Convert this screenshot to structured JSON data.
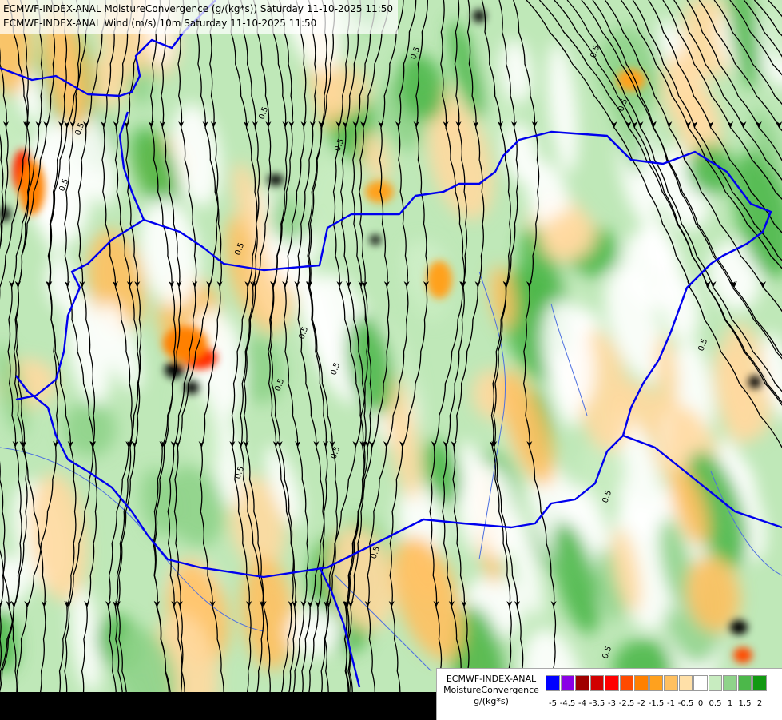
{
  "header": {
    "line1": "ECMWF-INDEX-ANAL MoistureConvergence (g/(kg*s)) Saturday 11-10-2025 11:50",
    "line2": "ECMWF-INDEX-ANAL Wind (m/s) 10m Saturday 11-10-2025 11:50"
  },
  "legend": {
    "model": "ECMWF-INDEX-ANAL",
    "parameter": "MoistureConvergence",
    "unit": "g/(kg*s)",
    "ticks": [
      "-5",
      "-4.5",
      "-4",
      "-3.5",
      "-3",
      "-2.5",
      "-2",
      "-1.5",
      "-1",
      "-0.5",
      "0",
      "0.5",
      "1",
      "1.5",
      "2"
    ],
    "colors": [
      "#0000ff",
      "#8a00e6",
      "#a00000",
      "#d10000",
      "#ff0000",
      "#ff4a00",
      "#ff8000",
      "#ffa11e",
      "#ffc060",
      "#ffe0a8",
      "#ffffff",
      "#c8ecc0",
      "#8fd38a",
      "#4cb84a",
      "#119911"
    ]
  },
  "map": {
    "border_color": "#0000ee",
    "streamline_color": "#000000",
    "contour_label": "0.5"
  }
}
